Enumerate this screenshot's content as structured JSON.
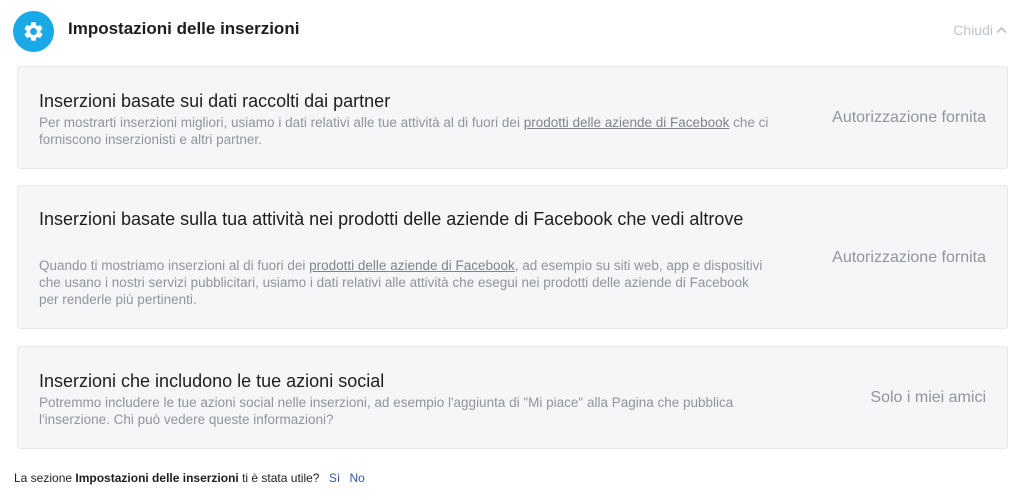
{
  "header": {
    "title": "Impostazioni delle inserzioni",
    "close_label": "Chiudi",
    "icon_color": "#1aa9e6"
  },
  "cards": [
    {
      "title": "Inserzioni basate sui dati raccolti dai partner",
      "desc_before": "Per mostrarti inserzioni migliori, usiamo i dati relativi alle tue attività al di fuori dei ",
      "desc_link": "prodotti delle aziende di Facebook",
      "desc_after": " che ci forniscono inserzionisti e altri partner.",
      "status": "Autorizzazione fornita"
    },
    {
      "title": "Inserzioni basate sulla tua attività nei prodotti delle aziende di Facebook che vedi altrove",
      "desc_before": "Quando ti mostriamo inserzioni al di fuori dei ",
      "desc_link": "prodotti delle aziende di Facebook",
      "desc_after": ", ad esempio su siti web, app e dispositivi che usano i nostri servizi pubblicitari, usiamo i dati relativi alle attività che esegui nei prodotti delle aziende di Facebook per renderle più pertinenti.",
      "status": "Autorizzazione fornita"
    },
    {
      "title": "Inserzioni che includono le tue azioni social",
      "desc_before": "Potremmo includere le tue azioni social nelle inserzioni, ad esempio l'aggiunta di \"Mi piace\" alla Pagina che pubblica l'inserzione. Chi può vedere queste informazioni?",
      "desc_link": "",
      "desc_after": "",
      "status": "Solo i miei amici"
    }
  ],
  "feedback": {
    "prefix": "La sezione ",
    "section_name": "Impostazioni delle inserzioni",
    "suffix": " ti è stata utile?",
    "yes": "Sì",
    "no": "No"
  }
}
